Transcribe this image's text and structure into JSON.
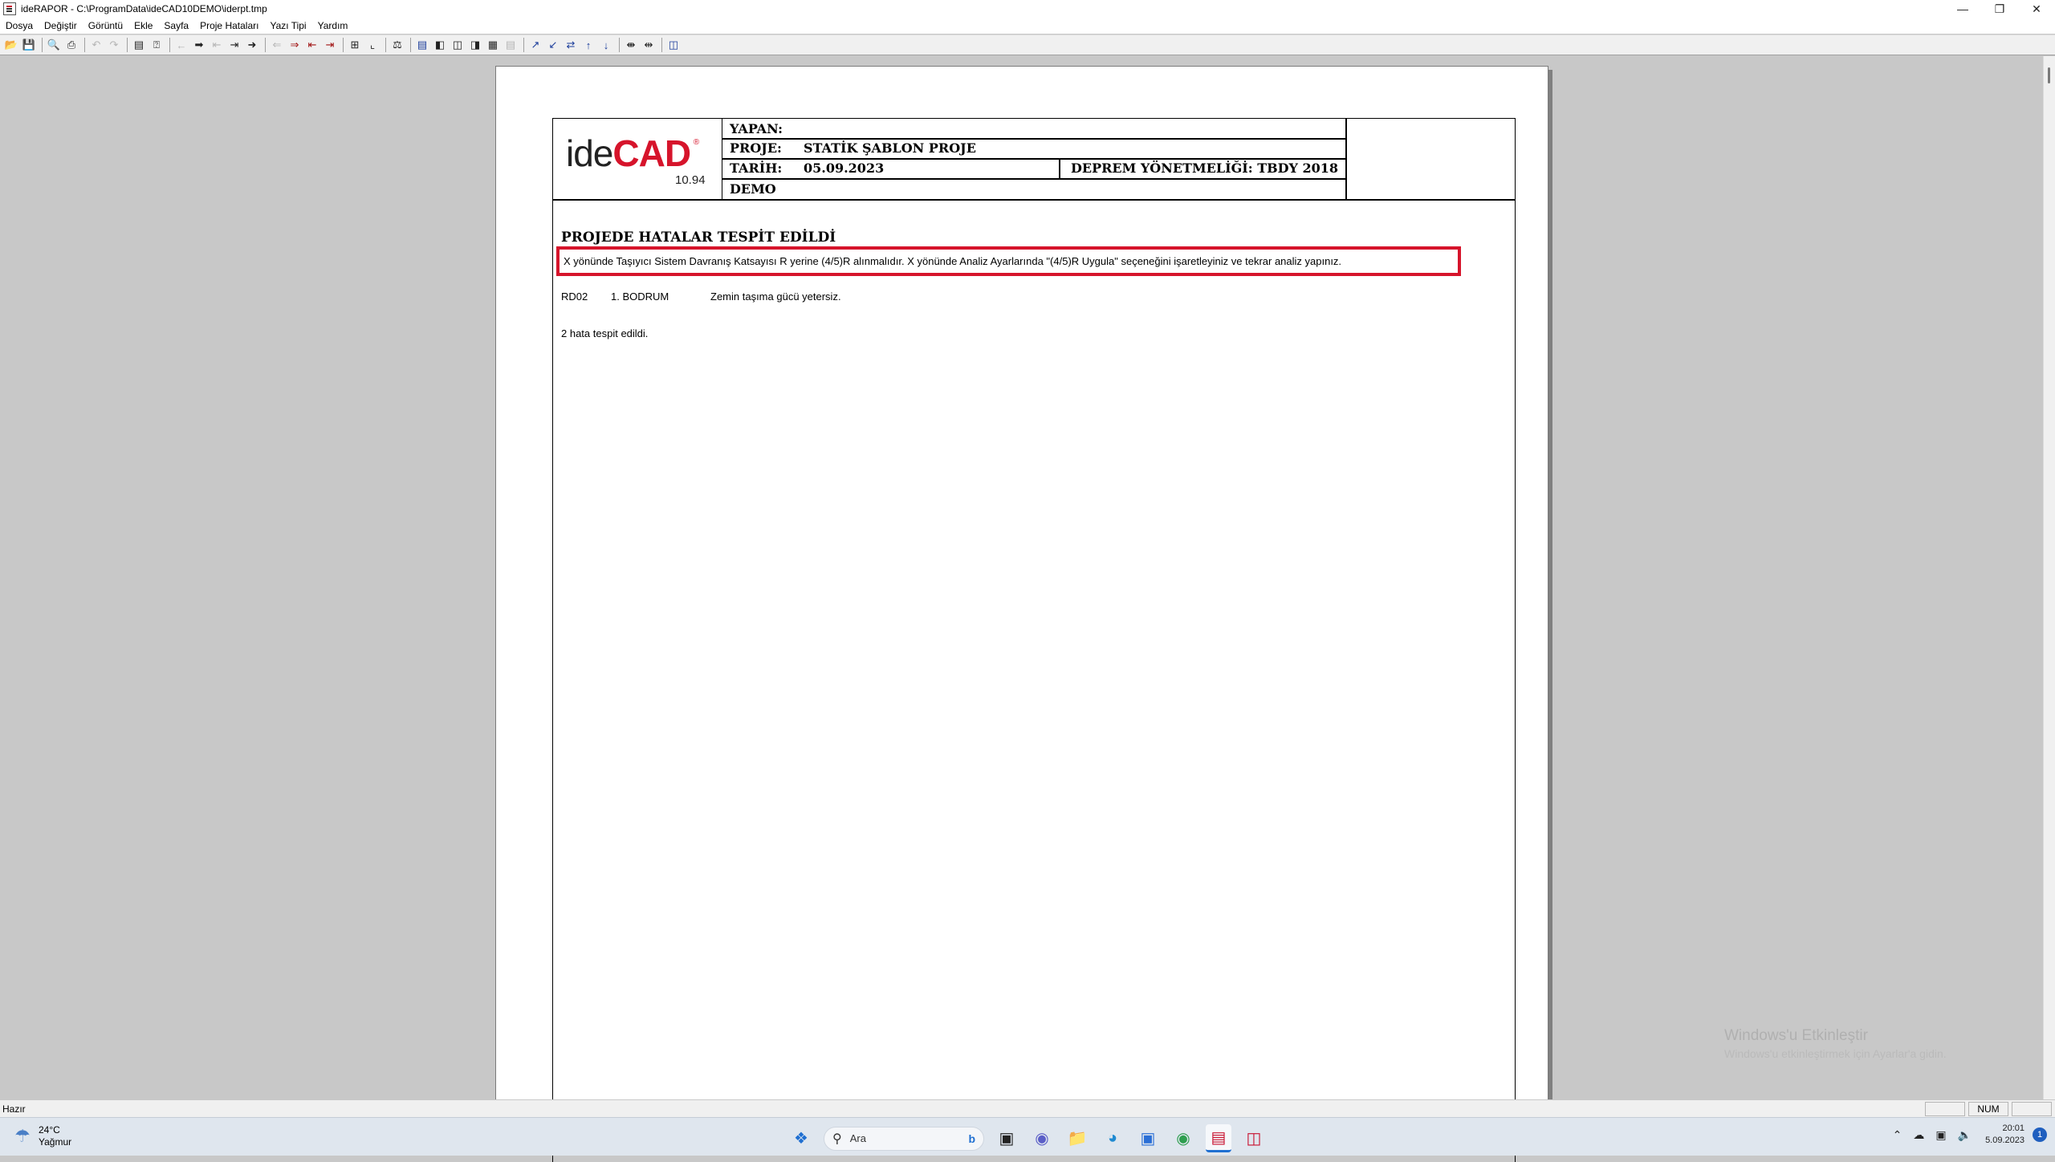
{
  "window": {
    "title": "ideRAPOR - C:\\ProgramData\\ideCAD10DEMO\\iderpt.tmp"
  },
  "menu": {
    "items": [
      "Dosya",
      "Değiştir",
      "Görüntü",
      "Ekle",
      "Sayfa",
      "Proje Hataları",
      "Yazı Tipi",
      "Yardım"
    ]
  },
  "report": {
    "logo_ide": "ide",
    "logo_cad": "CAD",
    "logo_reg": "®",
    "version": "10.94",
    "yapan_label": "YAPAN:",
    "yapan_value": "",
    "proje_label": "PROJE:",
    "proje_value": "STATİK ŞABLON PROJE",
    "tarih_label": "TARİH:",
    "tarih_value": "05.09.2023",
    "deprem": "DEPREM YÖNETMELİĞİ: TBDY 2018",
    "demo": "DEMO",
    "heading": "PROJEDE HATALAR TESPİT EDİLDİ",
    "highlighted_error": "X yönünde Taşıyıcı Sistem Davranış Katsayısı R yerine (4/5)R alınmalıdır.  X yönünde Analiz Ayarlarında \"(4/5)R Uygula\"  seçeneğini işaretleyiniz ve tekrar analiz yapınız.",
    "error_row": {
      "code": "RD02",
      "floor": "1. BODRUM",
      "message": "Zemin taşıma gücü yetersiz."
    },
    "summary": "2 hata tespit edildi."
  },
  "watermark": {
    "line1": "Windows'u Etkinleştir",
    "line2": "Windows'u etkinleştirmek için Ayarlar'a gidin."
  },
  "statusbar": {
    "ready": "Hazır",
    "num": "NUM"
  },
  "taskbar": {
    "temperature": "24°C",
    "condition": "Yağmur",
    "search_placeholder": "Ara",
    "time": "20:01",
    "date": "5.09.2023",
    "notification_count": "1"
  },
  "colors": {
    "accent_red": "#d6142b",
    "taskbar_bg": "#dfe6ee",
    "workspace_bg": "#c8c8c8"
  }
}
